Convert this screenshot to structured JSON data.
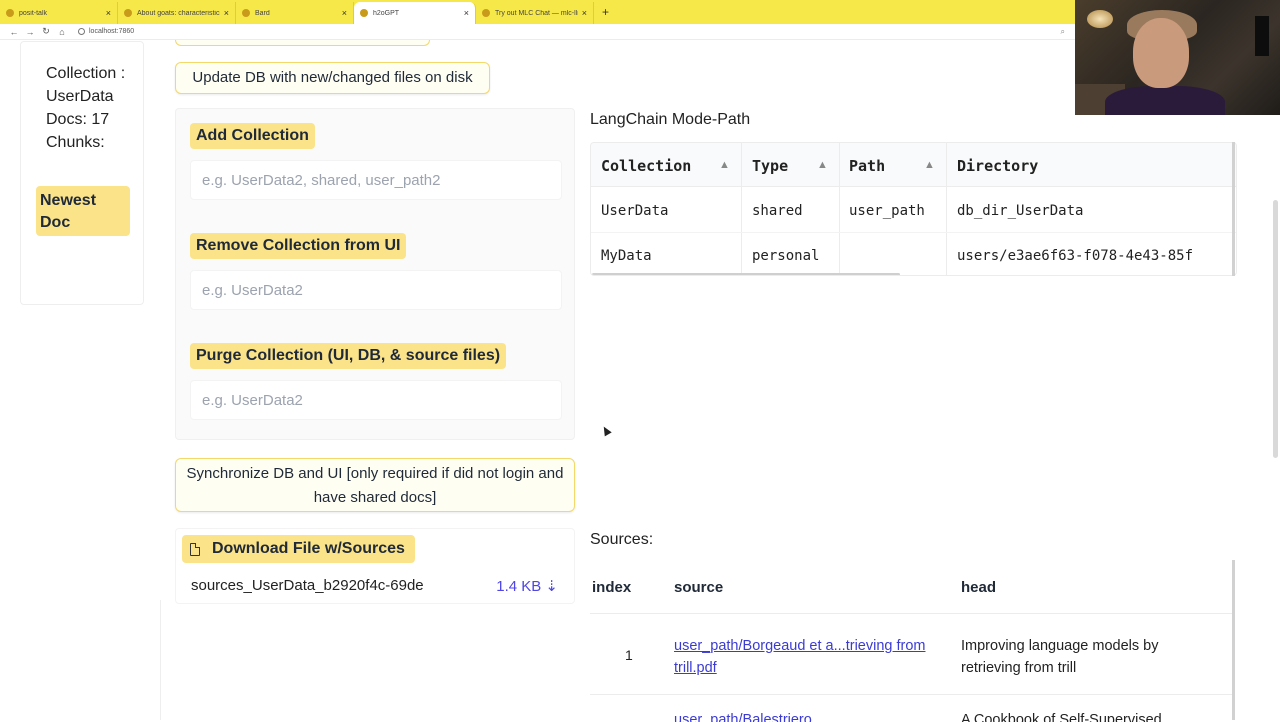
{
  "browser": {
    "tabs": [
      {
        "title": "posit-talk",
        "active": false
      },
      {
        "title": "About goats: characteristics a...",
        "active": false
      },
      {
        "title": "Bard",
        "active": false
      },
      {
        "title": "h2oGPT",
        "active": true
      },
      {
        "title": "Try out MLC Chat — mlc-llm 0...",
        "active": false
      }
    ],
    "new_tab_icon": "plus-icon",
    "url": "localhost:7860"
  },
  "sidebar": {
    "collection_info": "Collection : UserData Docs: 17 Chunks:",
    "newest_doc_button": "Newest Doc"
  },
  "buttons": {
    "update_db": "Update DB with new/changed files on disk",
    "synchronize": "Synchronize DB and UI [only required if did not login and have shared docs]"
  },
  "collections": {
    "add": {
      "label": "Add Collection",
      "placeholder": "e.g. UserData2, shared, user_path2"
    },
    "remove": {
      "label": "Remove Collection from UI",
      "placeholder": "e.g. UserData2"
    },
    "purge": {
      "label": "Purge Collection (UI, DB, & source files)",
      "placeholder": "e.g. UserData2"
    }
  },
  "download": {
    "label": "Download File w/Sources",
    "file_name": "sources_UserData_b2920f4c-69de",
    "file_size": "1.4 KB ⇣"
  },
  "langchain": {
    "title": "LangChain Mode-Path",
    "headers": [
      "Collection",
      "Type",
      "Path",
      "Directory"
    ],
    "rows": [
      [
        "UserData",
        "shared",
        "user_path",
        "db_dir_UserData"
      ],
      [
        "MyData",
        "personal",
        "",
        "users/e3ae6f63-f078-4e43-85f"
      ]
    ]
  },
  "sources": {
    "title": "Sources:",
    "headers": [
      "index",
      "source",
      "head"
    ],
    "rows": [
      {
        "index": "1",
        "source": "user_path/Borgeaud et a...trieving from trill.pdf",
        "head": "Improving language models by retrieving from trill"
      }
    ],
    "partial_row": {
      "source": "user_path/Balestriero",
      "head": "A Cookbook of Self-Supervised"
    }
  },
  "colors": {
    "tab_bar": "#f7e84a",
    "label_yellow": "#fbe38a",
    "link": "#3b3bd4"
  }
}
